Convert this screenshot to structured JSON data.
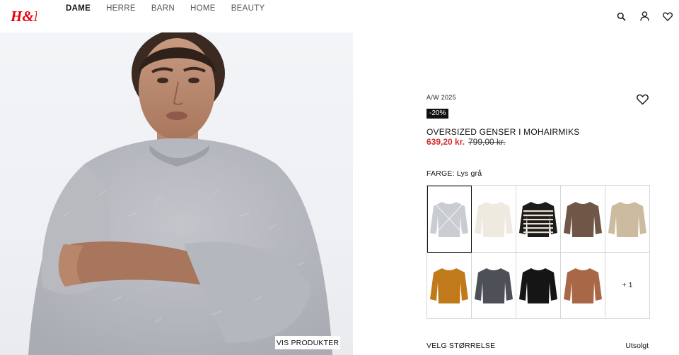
{
  "brand": {
    "logo_text": "H&M",
    "color": "#e50010"
  },
  "nav": {
    "items": [
      {
        "label": "DAME",
        "active": true
      },
      {
        "label": "HERRE",
        "active": false
      },
      {
        "label": "BARN",
        "active": false
      },
      {
        "label": "HOME",
        "active": false
      },
      {
        "label": "BEAUTY",
        "active": false
      }
    ]
  },
  "header_icons": [
    "search-icon",
    "account-icon",
    "heart-icon"
  ],
  "hero": {
    "button_label": "VIS PRODUKTER"
  },
  "product": {
    "season": "A/W 2025",
    "discount_badge": "-20%",
    "title": "OVERSIZED GENSER I MOHAIRMIKS",
    "price_new": "639,20 kr.",
    "price_old": "799,00 kr.",
    "price_color": "#d12b2b",
    "color_label": "FARGE: Lys grå",
    "swatches": [
      {
        "color": "#c9ccd1",
        "selected": true,
        "stripes": false
      },
      {
        "color": "#efeae0",
        "selected": false,
        "stripes": false
      },
      {
        "color": "#1c1c1c",
        "selected": false,
        "stripes": true
      },
      {
        "color": "#6f5646",
        "selected": false,
        "stripes": false
      },
      {
        "color": "#cdbba0",
        "selected": false,
        "stripes": false
      },
      {
        "color": "#c07a1c",
        "selected": false,
        "stripes": false
      },
      {
        "color": "#4e5058",
        "selected": false,
        "stripes": false
      },
      {
        "color": "#151515",
        "selected": false,
        "stripes": false
      },
      {
        "color": "#a86848",
        "selected": false,
        "stripes": false
      }
    ],
    "more_label": "+ 1",
    "size_label": "VELG STØRRELSE",
    "size_status": "Utsolgt"
  }
}
